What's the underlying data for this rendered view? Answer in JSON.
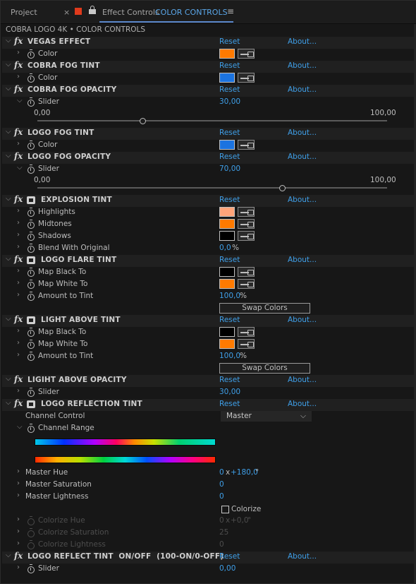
{
  "tabs": {
    "project": "Project",
    "close": "×",
    "effect_label": "Effect Controls",
    "comp_name": "COLOR CONTROLS",
    "menu": "≡"
  },
  "subheader": "COBRA LOGO 4K • COLOR CONTROLS",
  "common": {
    "reset": "Reset",
    "about": "About..."
  },
  "effects": [
    {
      "name": "VEGAS EFFECT",
      "props": [
        {
          "label": "Color",
          "color": "#ff7a00"
        }
      ]
    },
    {
      "name": "COBRA FOG TINT",
      "props": [
        {
          "label": "Color",
          "color": "#1b73e0"
        }
      ]
    },
    {
      "name": "COBRA FOG OPACITY",
      "props": [
        {
          "label": "Slider",
          "value": "30,00"
        }
      ],
      "slider": {
        "min": "0,00",
        "max": "100,00",
        "value": 30
      }
    },
    {
      "name": "LOGO FOG TINT",
      "props": [
        {
          "label": "Color",
          "color": "#1b73e0"
        }
      ]
    },
    {
      "name": "LOGO FOG OPACITY",
      "props": [
        {
          "label": "Slider",
          "value": "70,00"
        }
      ],
      "slider": {
        "min": "0,00",
        "max": "100,00",
        "value": 70
      }
    },
    {
      "name": "EXPLOSION TINT",
      "props": [
        {
          "label": "Highlights",
          "color": "#ffa47a"
        },
        {
          "label": "Midtones",
          "color": "#ff7a00"
        },
        {
          "label": "Shadows",
          "color": "#000000"
        },
        {
          "label": "Blend With Original",
          "value": "0,0",
          "unit": "%"
        }
      ]
    },
    {
      "name": "LOGO FLARE TINT",
      "props": [
        {
          "label": "Map Black To",
          "color": "#000000"
        },
        {
          "label": "Map White To",
          "color": "#ff7a00"
        },
        {
          "label": "Amount to Tint",
          "value": "100,0",
          "unit": "%"
        }
      ],
      "button": "Swap Colors"
    },
    {
      "name": "LIGHT ABOVE TINT",
      "props": [
        {
          "label": "Map Black To",
          "color": "#000000"
        },
        {
          "label": "Map White To",
          "color": "#ff7a00"
        },
        {
          "label": "Amount to Tint",
          "value": "100,0",
          "unit": "%"
        }
      ],
      "button": "Swap Colors"
    },
    {
      "name": "LIGIHT ABOVE OPACITY",
      "props": [
        {
          "label": "Slider",
          "value": "30,00"
        }
      ]
    },
    {
      "name": "LOGO REFLECTION TINT",
      "channel_control_label": "Channel Control",
      "channel_control_value": "Master",
      "channel_range_label": "Channel Range",
      "props": [
        {
          "label": "Master Hue",
          "value_a": "0",
          "x": "x",
          "value_b": "+180,0",
          "unit": "°"
        },
        {
          "label": "Master Saturation",
          "value": "0"
        },
        {
          "label": "Master Lightness",
          "value": "0"
        }
      ],
      "colorize_label": "Colorize",
      "disabled_props": [
        {
          "label": "Colorize Hue",
          "value_a": "0",
          "x": "x",
          "value_b": "+0,0",
          "unit": "°"
        },
        {
          "label": "Colorize Saturation",
          "value": "25"
        },
        {
          "label": "Colorize Lightness",
          "value": "0"
        }
      ]
    },
    {
      "name": "LOGO REFLECT TINT  ON/OFF  (100-ON/0-OFF)",
      "props": [
        {
          "label": "Slider",
          "value": "0,00"
        }
      ]
    }
  ]
}
